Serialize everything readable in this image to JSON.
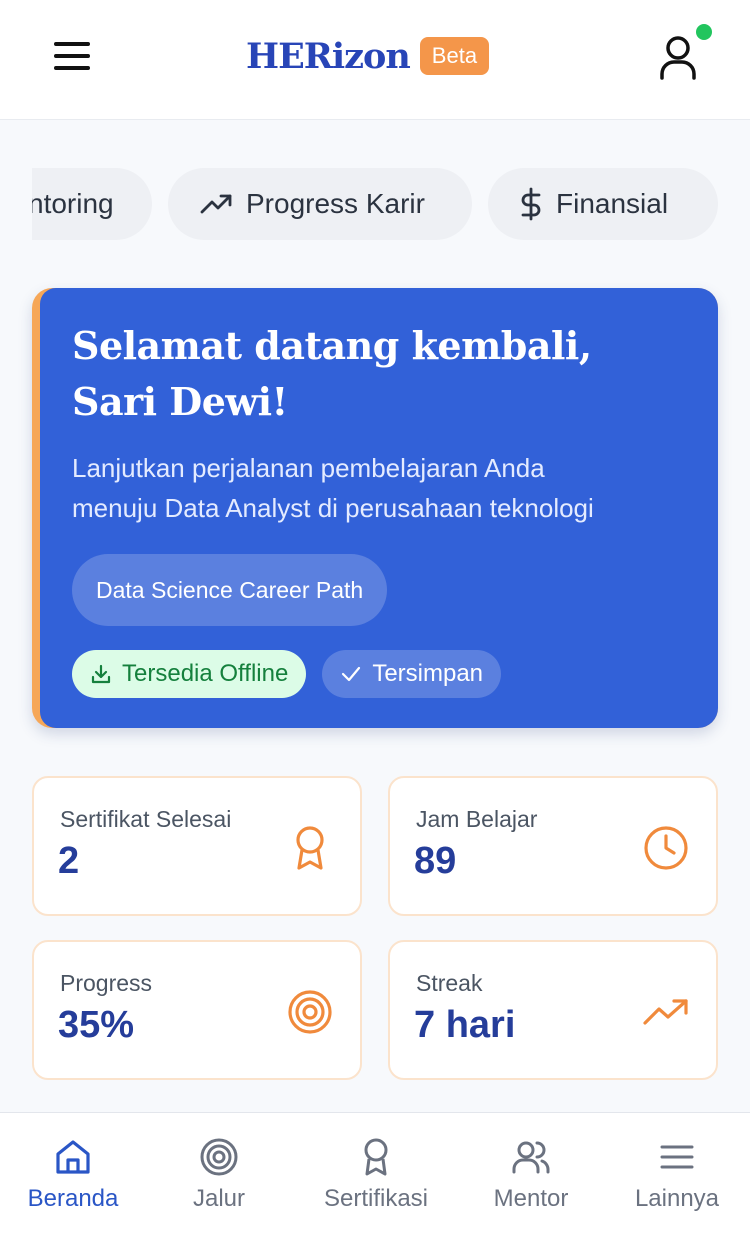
{
  "header": {
    "brand": "HERizon",
    "badge": "Beta"
  },
  "categories": [
    {
      "label": "Mentoring",
      "visible_label": "ntoring",
      "icon": "mentoring-icon"
    },
    {
      "label": "Progress Karir",
      "icon": "trending-up-icon"
    },
    {
      "label": "Finansial",
      "icon": "dollar-icon"
    }
  ],
  "welcome": {
    "title_line1": "Selamat datang kembali,",
    "title_line2": "Sari Dewi!",
    "subtitle_line1": "Lanjutkan perjalanan pembelajaran Anda",
    "subtitle_line2": "menuju Data Analyst di perusahaan teknologi",
    "path": "Data Science Career Path",
    "tag_offline": "Tersedia Offline",
    "tag_saved": "Tersimpan"
  },
  "stats": [
    {
      "label": "Sertifikat Selesai",
      "value": "2",
      "icon": "award-icon"
    },
    {
      "label": "Jam Belajar",
      "value": "89",
      "icon": "clock-icon"
    },
    {
      "label": "Progress",
      "value": "35%",
      "icon": "target-icon"
    },
    {
      "label": "Streak",
      "value": "7 hari",
      "icon": "trending-up-icon"
    }
  ],
  "nav": [
    {
      "label": "Beranda",
      "icon": "home-icon",
      "active": true
    },
    {
      "label": "Jalur",
      "icon": "target-icon"
    },
    {
      "label": "Sertifikasi",
      "icon": "award-icon"
    },
    {
      "label": "Mentor",
      "icon": "users-icon"
    },
    {
      "label": "Lainnya",
      "icon": "menu-icon"
    }
  ],
  "colors": {
    "brand": "#2845b7",
    "accent": "#f4964a",
    "card": "#3261d8",
    "success": "#15803d",
    "active_nav": "#2a56c6"
  }
}
